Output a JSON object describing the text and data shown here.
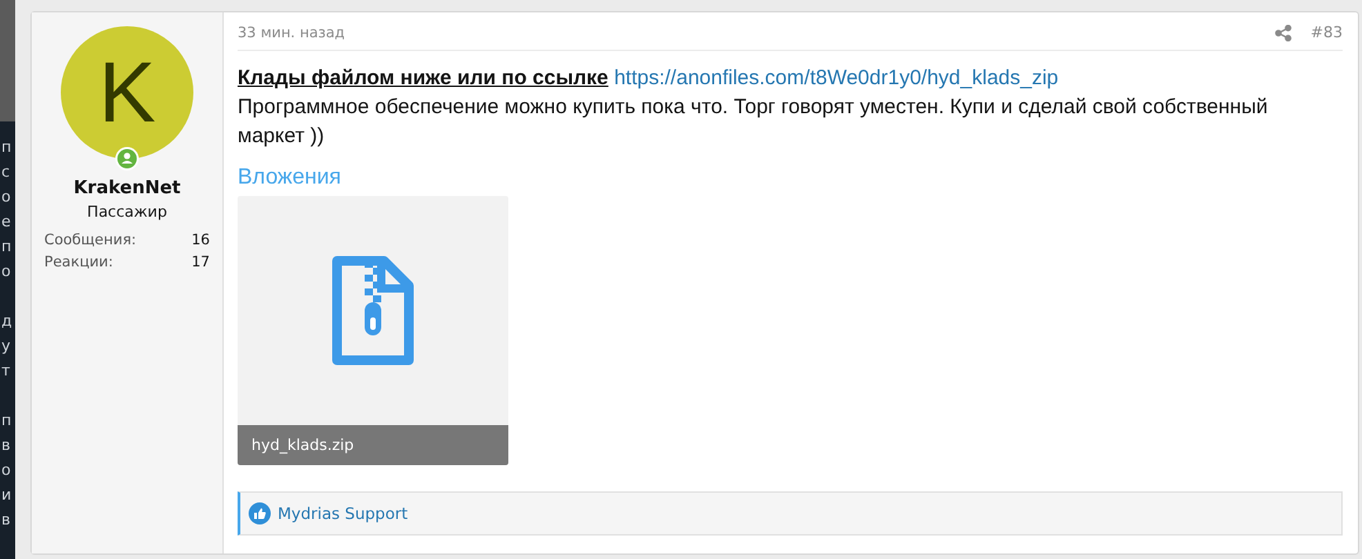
{
  "background_fragments": [
    [
      "п",
      "с",
      "о",
      "е",
      "п",
      "о"
    ],
    [
      "д",
      "у",
      "т"
    ],
    [
      "п",
      "в",
      "о",
      "и",
      "в"
    ]
  ],
  "user": {
    "avatar_letter": "K",
    "online": true,
    "name": "KrakenNet",
    "role": "Пассажир",
    "stats": [
      {
        "label": "Сообщения:",
        "value": "16"
      },
      {
        "label": "Реакции:",
        "value": "17"
      }
    ]
  },
  "post": {
    "time": "33 мин. назад",
    "number": "#83",
    "title": "Клады файлом ниже или по ссылке",
    "link": "https://anonfiles.com/t8We0dr1y0/hyd_klads_zip",
    "body": "Программное обеспечение можно купить пока что. Торг говорят уместен. Купи и сделай свой собственный маркет ))",
    "attachments_heading": "Вложения",
    "attachments": [
      {
        "filename": "hyd_klads.zip"
      }
    ],
    "reactions": "Mydrias Support"
  }
}
